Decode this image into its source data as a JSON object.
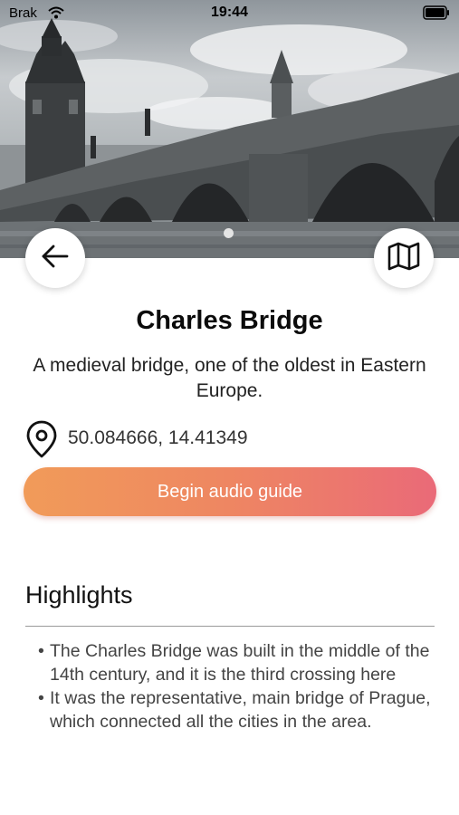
{
  "status_bar": {
    "carrier": "Brak",
    "time": "19:44"
  },
  "landmark": {
    "title": "Charles Bridge",
    "description": "A medieval bridge, one of the oldest in Eastern Europe.",
    "coordinates": "50.084666, 14.41349"
  },
  "actions": {
    "audio_guide_label": "Begin audio guide"
  },
  "highlights": {
    "heading": "Highlights",
    "items": [
      "The Charles Bridge was built in the middle of the 14th century, and it is the third crossing here",
      "It was the representative, main bridge of Prague, which connected all the cities in the area."
    ],
    "bullet": "•"
  },
  "icons": {
    "back": "arrow-left-icon",
    "map": "map-icon",
    "location": "location-pin-icon",
    "wifi": "wifi-icon",
    "battery": "battery-icon"
  },
  "colors": {
    "button_gradient_start": "#f19b59",
    "button_gradient_end": "#ea6a78",
    "button_text": "#ffffff"
  }
}
